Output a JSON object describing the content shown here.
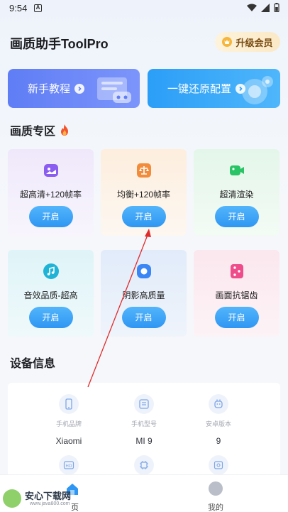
{
  "status_bar": {
    "time": "9:54",
    "notification_letter": "A"
  },
  "header": {
    "title": "画质助手ToolPro",
    "vip_label": "升级会员"
  },
  "banners": [
    {
      "label": "新手教程"
    },
    {
      "label": "一键还原配置"
    }
  ],
  "quality_section": {
    "title": "画质专区"
  },
  "cards": [
    {
      "label": "超高清+120帧率",
      "button": "开启",
      "icon": "image-icon",
      "bg": "#f1ebfb",
      "icon_color": "#8a5cf0"
    },
    {
      "label": "均衡+120帧率",
      "button": "开启",
      "icon": "scale-icon",
      "bg": "#fdf1e7",
      "icon_color": "#f28c3b"
    },
    {
      "label": "超清渲染",
      "button": "开启",
      "icon": "video-camera-icon",
      "bg": "#eaf8ee",
      "icon_color": "#29c466"
    },
    {
      "label": "音效品质-超高",
      "button": "开启",
      "icon": "music-note-icon",
      "bg": "#e6f6fa",
      "icon_color": "#1fb3d6"
    },
    {
      "label": "阴影高质量",
      "button": "开启",
      "icon": "shadow-icon",
      "bg": "#e8f0fb",
      "icon_color": "#3a86f5"
    },
    {
      "label": "画面抗锯齿",
      "button": "开启",
      "icon": "dice-icon",
      "bg": "#fbecf1",
      "icon_color": "#ee4c8a"
    }
  ],
  "device_section": {
    "title": "设备信息",
    "items": [
      {
        "label": "手机品牌",
        "value": "Xiaomi",
        "icon": "phone-icon"
      },
      {
        "label": "手机型号",
        "value": "MI 9",
        "icon": "card-icon"
      },
      {
        "label": "安卓版本",
        "value": "9",
        "icon": "android-icon"
      }
    ]
  },
  "bottom_nav": {
    "home_label": "页",
    "me_label": "我的"
  },
  "watermark": {
    "text": "安心下载网",
    "url": "www.java800.com"
  },
  "colors": {
    "accent": "#2f96f3",
    "banner1": "#6b86f7",
    "banner2": "#3aa8f9",
    "vip_text": "#7a4c12",
    "annotation_arrow": "#e02b2b"
  }
}
